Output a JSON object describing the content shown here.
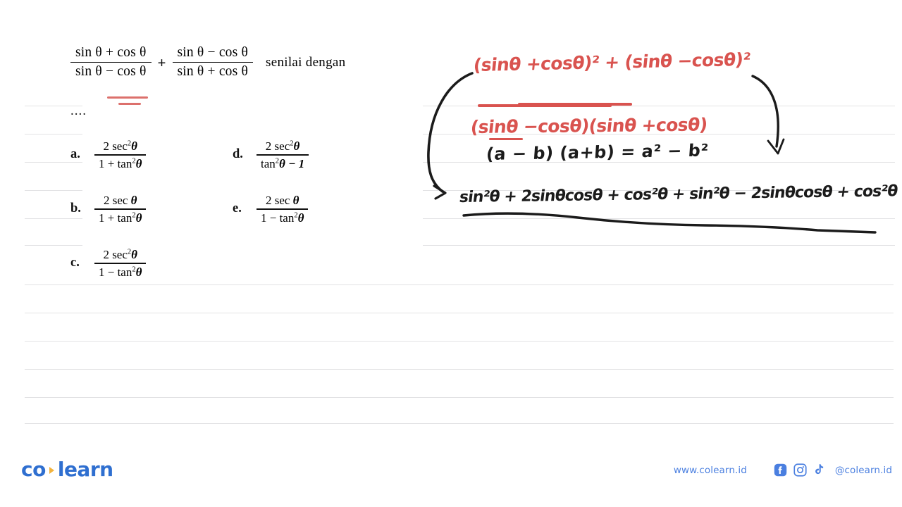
{
  "question": {
    "fraction1": {
      "numerator": "sin θ + cos θ",
      "denominator": "sin θ − cos θ"
    },
    "operator": "+",
    "fraction2": {
      "numerator": "sin θ − cos θ",
      "denominator": "sin θ + cos θ"
    },
    "tail_text": "senilai  dengan",
    "blank": "...."
  },
  "options": [
    {
      "letter": "a.",
      "numerator": "2 sec",
      "num_exp": "2",
      "num_var": "θ",
      "denominator": "1 + tan",
      "den_exp": "2",
      "den_var": "θ"
    },
    {
      "letter": "b.",
      "numerator": "2 sec ",
      "num_exp": "",
      "num_var": "θ",
      "denominator": "1 + tan",
      "den_exp": "2",
      "den_var": "θ"
    },
    {
      "letter": "c.",
      "numerator": "2 sec",
      "num_exp": "2",
      "num_var": "θ",
      "denominator": "1 − tan",
      "den_exp": "2",
      "den_var": "θ"
    },
    {
      "letter": "d.",
      "numerator": "2 sec",
      "num_exp": "2",
      "num_var": "θ",
      "denominator": "tan",
      "den_exp": "2",
      "den_var": "θ − 1"
    },
    {
      "letter": "e.",
      "numerator": "2 sec ",
      "num_exp": "",
      "num_var": "θ",
      "denominator": "1 − tan",
      "den_exp": "2",
      "den_var": "θ"
    }
  ],
  "annotations": {
    "numerator_line": "(sinθ +cosθ)² + (sinθ −cosθ)²",
    "denominator_line": "(sinθ −cosθ)(sinθ +cosθ)",
    "identity_note": "(a − b)  (a+b)  = a² − b²",
    "expansion_line": "sin²θ + 2sinθcosθ + cos²θ + sin²θ − 2sinθcosθ + cos²θ",
    "pen_red": "#d9534f",
    "pen_black": "#1b1b1b"
  },
  "footer": {
    "logo_part1": "co",
    "logo_part2": "learn",
    "website": "www.colearn.id",
    "handle": "@colearn.id",
    "socials": [
      "facebook-icon",
      "instagram-icon",
      "tiktok-icon"
    ],
    "brand_blue": "#2f6fd0",
    "accent_yellow": "#f2b33d"
  }
}
